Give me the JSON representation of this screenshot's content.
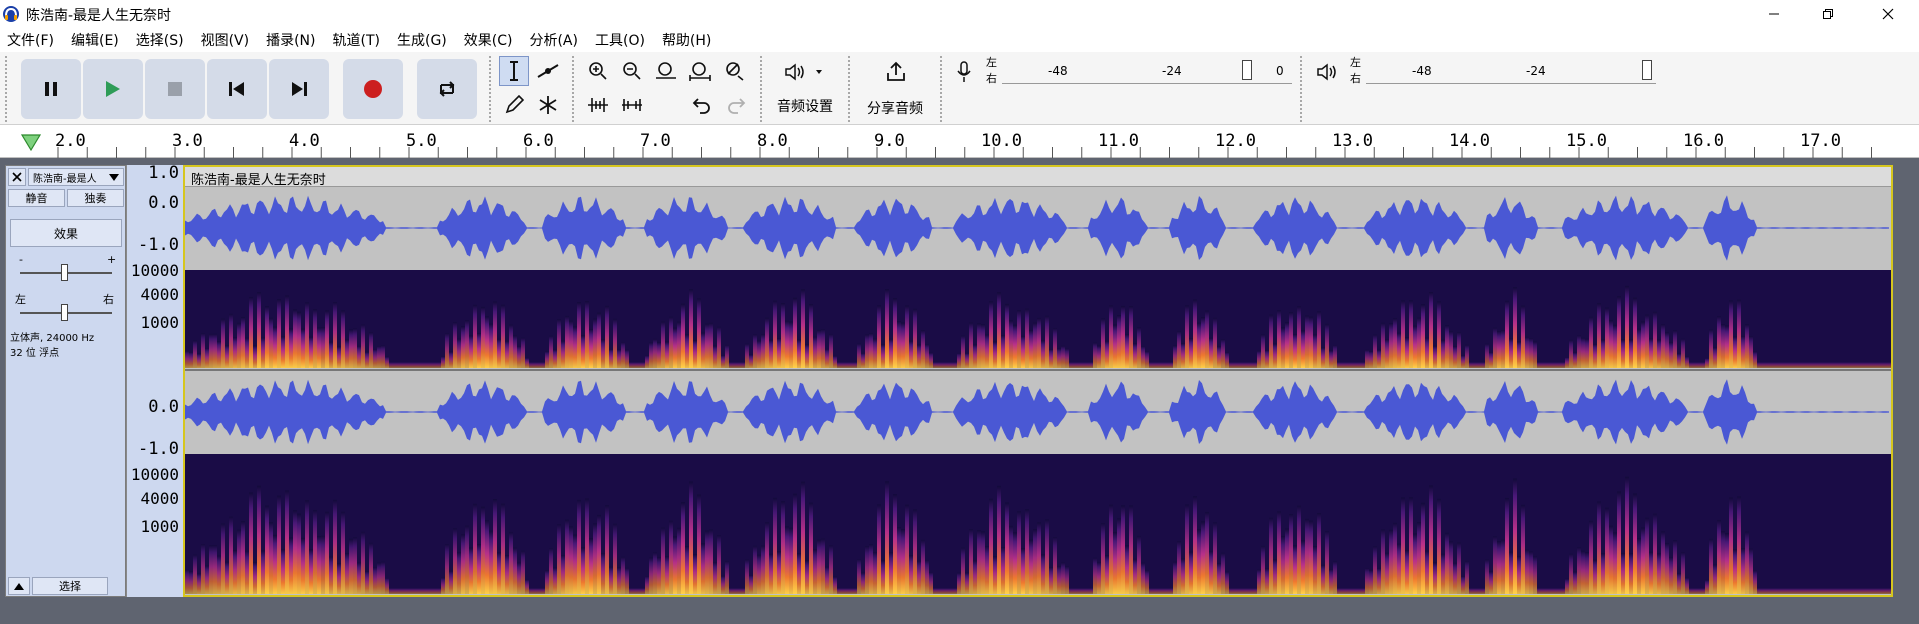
{
  "window": {
    "title": "陈浩南-最是人生无奈时"
  },
  "menu": [
    "文件(F)",
    "编辑(E)",
    "选择(S)",
    "视图(V)",
    "播录(N)",
    "轨道(T)",
    "生成(G)",
    "效果(C)",
    "分析(A)",
    "工具(O)",
    "帮助(H)"
  ],
  "toolbar": {
    "audio_setup_label": "音频设置",
    "share_label": "分享音频",
    "rec_meter": {
      "l": "左",
      "r": "右",
      "marks": [
        "-48",
        "-24",
        "0"
      ]
    },
    "play_meter": {
      "l": "左",
      "r": "右",
      "marks": [
        "-48",
        "-24"
      ]
    }
  },
  "ruler": {
    "ticks": [
      "2.0",
      "3.0",
      "4.0",
      "5.0",
      "6.0",
      "7.0",
      "8.0",
      "9.0",
      "10.0",
      "11.0",
      "12.0",
      "13.0",
      "14.0",
      "15.0",
      "16.0",
      "17.0"
    ]
  },
  "track": {
    "name": "陈浩南-最是人",
    "clip_title": "陈浩南-最是人生无奈时",
    "mute": "静音",
    "solo": "独奏",
    "effects": "效果",
    "gain_minus": "-",
    "gain_plus": "+",
    "pan_left": "左",
    "pan_right": "右",
    "info_line1": "立体声, 24000 Hz",
    "info_line2": "32 位 浮点",
    "select": "选择"
  },
  "vertical_ruler": {
    "wave1": [
      "1.0",
      "0.0",
      "-1.0"
    ],
    "spec1": [
      "10000",
      "4000",
      "1000"
    ],
    "wave2": [
      "0.0",
      "-1.0"
    ],
    "spec2": [
      "10000",
      "4000",
      "1000"
    ]
  },
  "colors": {
    "waveform": "#4a58d4",
    "wave_bg": "#c2c2c2",
    "selection_border": "#d6c61e",
    "panel_bg": "#cdd8ef"
  }
}
